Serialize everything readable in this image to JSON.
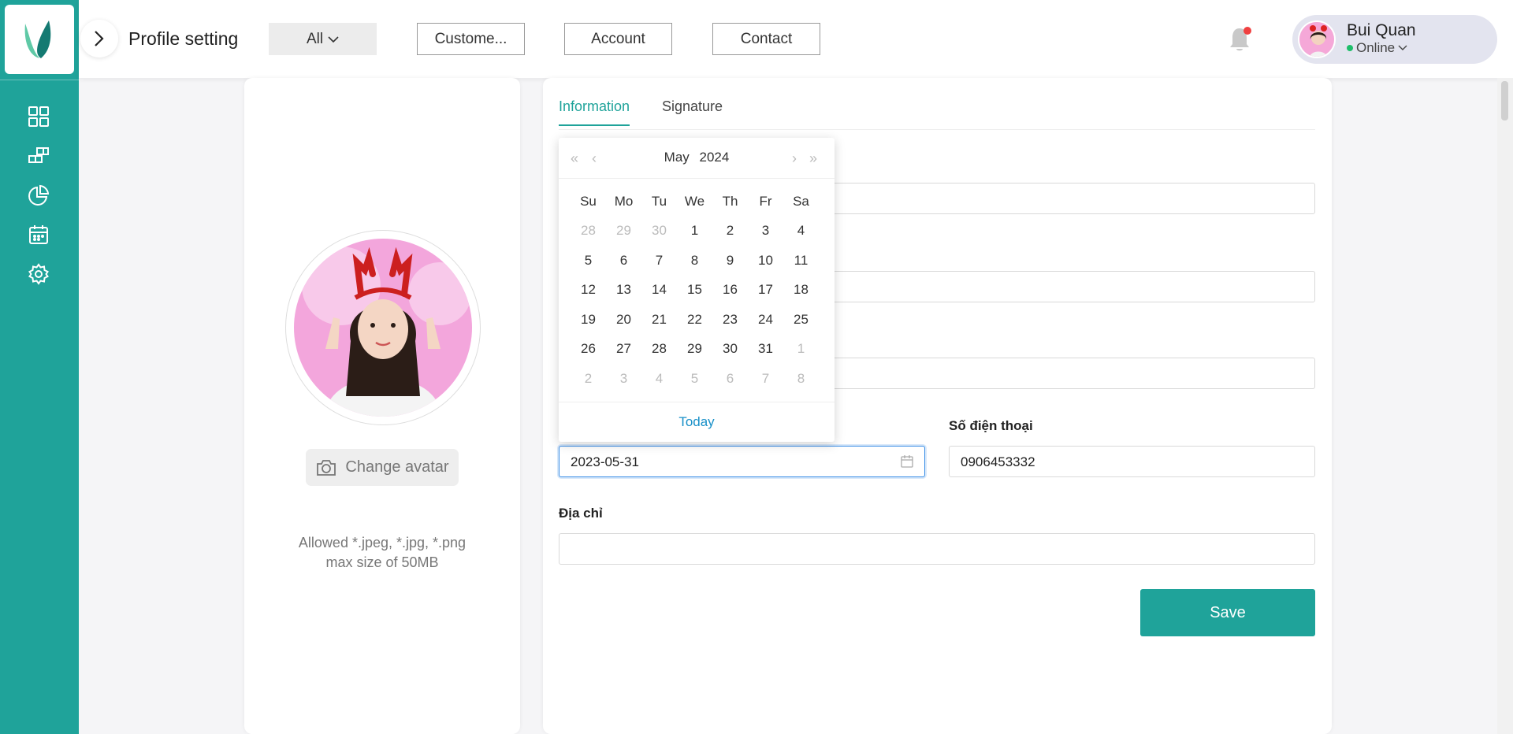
{
  "header": {
    "page_title": "Profile setting",
    "nav": [
      "All",
      "Custome...",
      "Account",
      "Contact"
    ]
  },
  "user": {
    "name": "Bui Quan",
    "status": "Online"
  },
  "sidebar": {
    "icons": [
      "dashboard-icon",
      "blocks-icon",
      "pie-chart-icon",
      "calendar-icon",
      "settings-icon"
    ]
  },
  "profile": {
    "change_avatar": "Change avatar",
    "allowed_line1": "Allowed *.jpeg, *.jpg, *.png",
    "allowed_line2": "max size of 50MB"
  },
  "tabs": [
    "Information",
    "Signature"
  ],
  "form": {
    "birthday_value": "2023-05-31",
    "phone_label": "Số điện thoại",
    "phone_value": "0906453332",
    "address_label": "Địa chỉ",
    "address_value": "",
    "save_label": "Save"
  },
  "calendar": {
    "month": "May",
    "year": "2024",
    "weekdays": [
      "Su",
      "Mo",
      "Tu",
      "We",
      "Th",
      "Fr",
      "Sa"
    ],
    "weeks": [
      [
        "28",
        "29",
        "30",
        "1",
        "2",
        "3",
        "4"
      ],
      [
        "5",
        "6",
        "7",
        "8",
        "9",
        "10",
        "11"
      ],
      [
        "12",
        "13",
        "14",
        "15",
        "16",
        "17",
        "18"
      ],
      [
        "19",
        "20",
        "21",
        "22",
        "23",
        "24",
        "25"
      ],
      [
        "26",
        "27",
        "28",
        "29",
        "30",
        "31",
        "1"
      ],
      [
        "2",
        "3",
        "4",
        "5",
        "6",
        "7",
        "8"
      ]
    ],
    "today_label": "Today"
  },
  "colors": {
    "accent": "#1fa39a",
    "link": "#1890c8",
    "notify": "#f04040",
    "online": "#1fbe6a"
  }
}
